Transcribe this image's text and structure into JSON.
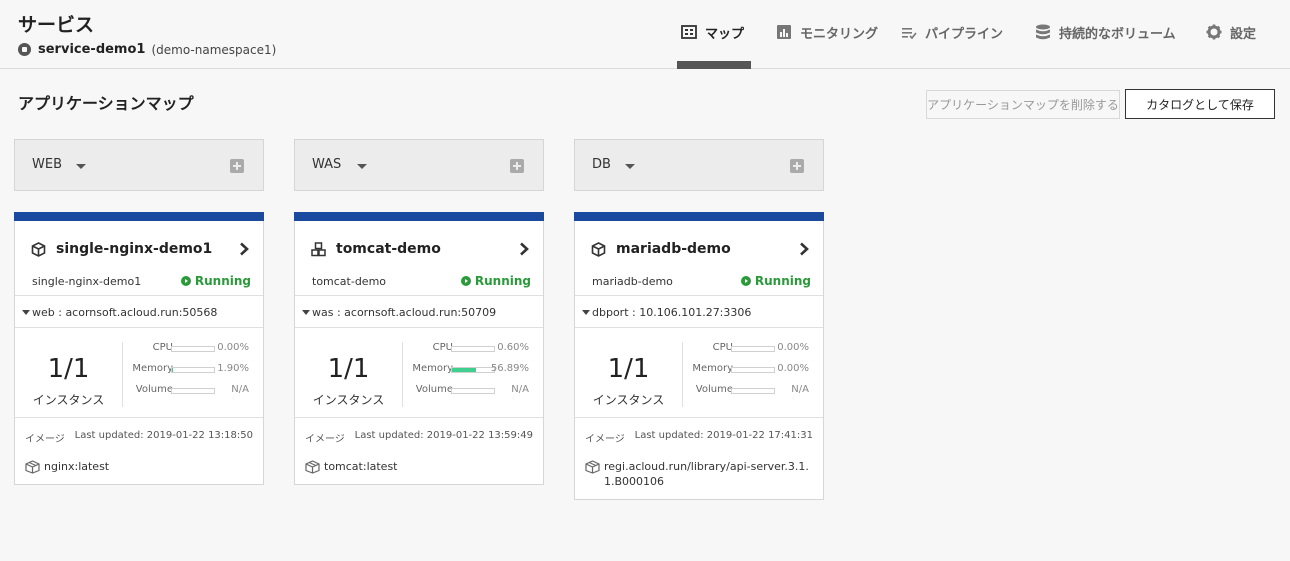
{
  "header": {
    "title": "サービス",
    "service_name": "service-demo1",
    "namespace": "(demo-namespace1)"
  },
  "tabs": [
    {
      "label": "マップ",
      "icon": "map-icon",
      "active": true
    },
    {
      "label": "モニタリング",
      "icon": "chart-icon",
      "active": false
    },
    {
      "label": "パイプライン",
      "icon": "pipeline-icon",
      "active": false
    },
    {
      "label": "持続的なボリューム",
      "icon": "database-icon",
      "active": false
    },
    {
      "label": "設定",
      "icon": "gear-icon",
      "active": false
    }
  ],
  "main": {
    "title": "アプリケーションマップ",
    "delete_button": "アプリケーションマップを削除する",
    "save_button": "カタログとして保存"
  },
  "labels": {
    "instance": "インスタンス",
    "cpu": "CPU",
    "memory": "Memory",
    "volume": "Volume",
    "image": "イメージ",
    "status": "Running"
  },
  "colors": {
    "accent_bar": "#1a4aa0",
    "running": "#2a9a3a",
    "memory_fill": "#3fcf8e"
  },
  "columns": [
    {
      "name": "WEB",
      "card": {
        "title": "single-nginx-demo1",
        "icon": "cube-icon",
        "subtitle": "single-nginx-demo1",
        "status": "Running",
        "endpoint": "web : acornsoft.acloud.run:50568",
        "instances": "1/1",
        "cpu": "0.00%",
        "memory": "1.90%",
        "volume": "N/A",
        "cpu_fraction": 0.0,
        "memory_fraction": 0.019,
        "last_updated": "Last updated: 2019-01-22 13:18:50",
        "image": "nginx:latest"
      }
    },
    {
      "name": "WAS",
      "card": {
        "title": "tomcat-demo",
        "icon": "cubes-icon",
        "subtitle": "tomcat-demo",
        "status": "Running",
        "endpoint": "was : acornsoft.acloud.run:50709",
        "instances": "1/1",
        "cpu": "0.60%",
        "memory": "56.89%",
        "volume": "N/A",
        "cpu_fraction": 0.006,
        "memory_fraction": 0.5689,
        "last_updated": "Last updated: 2019-01-22 13:59:49",
        "image": "tomcat:latest"
      }
    },
    {
      "name": "DB",
      "card": {
        "title": "mariadb-demo",
        "icon": "cube-icon",
        "subtitle": "mariadb-demo",
        "status": "Running",
        "endpoint": "dbport : 10.106.101.27:3306",
        "instances": "1/1",
        "cpu": "0.00%",
        "memory": "0.00%",
        "volume": "N/A",
        "cpu_fraction": 0.0,
        "memory_fraction": 0.0,
        "last_updated": "Last updated: 2019-01-22 17:41:31",
        "image": "regi.acloud.run/library/api-server.3.1.1.B000106"
      }
    }
  ]
}
